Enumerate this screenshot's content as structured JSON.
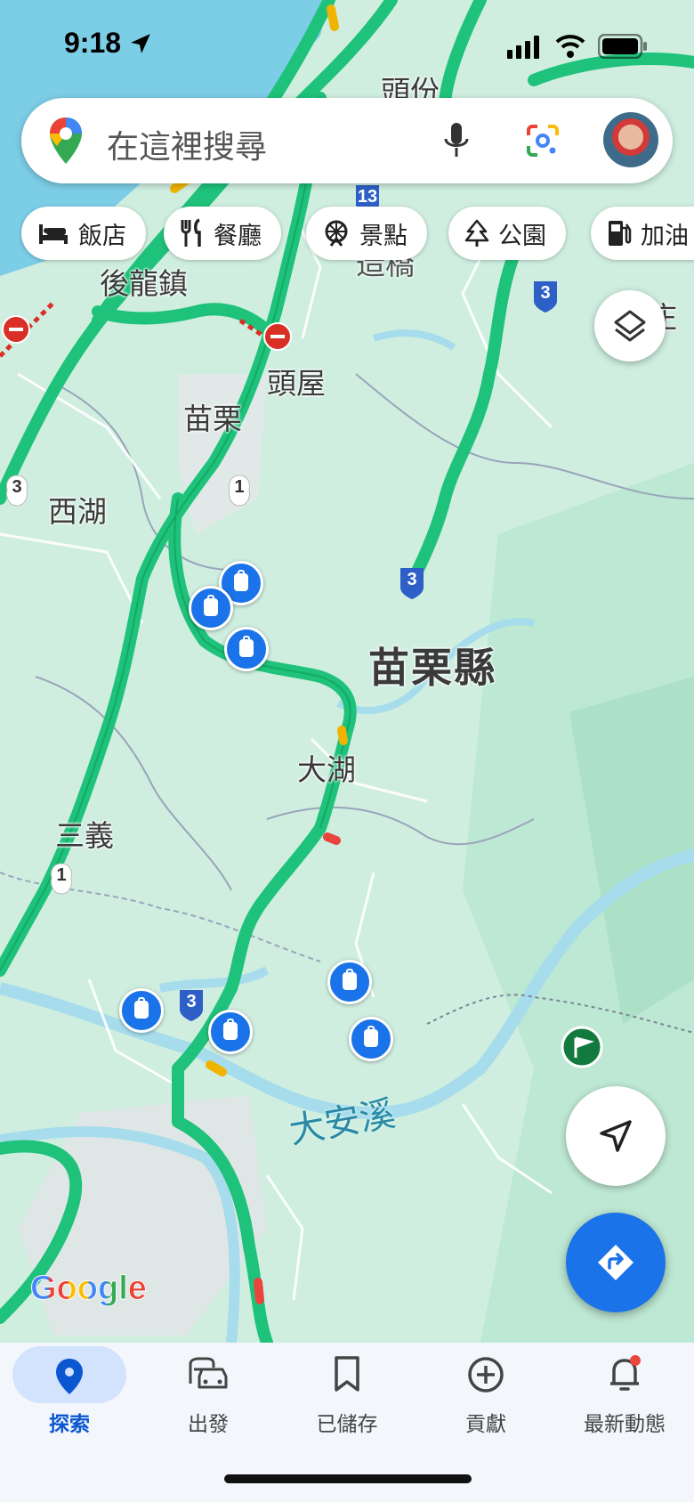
{
  "status_bar": {
    "time": "9:18"
  },
  "search": {
    "placeholder": "在這裡搜尋"
  },
  "chips": [
    {
      "label": "飯店",
      "icon": "bed-icon"
    },
    {
      "label": "餐廳",
      "icon": "restaurant-icon"
    },
    {
      "label": "景點",
      "icon": "attraction-icon"
    },
    {
      "label": "公園",
      "icon": "park-tree-icon"
    },
    {
      "label": "加油",
      "icon": "gas-station-icon"
    }
  ],
  "map": {
    "places": {
      "toufen": "頭份",
      "houlong": "後龍鎮",
      "touwu": "頭屋",
      "miaoli": "苗栗",
      "xihu": "西湖",
      "county": "苗栗縣",
      "dahu": "大湖",
      "sanyi": "三義",
      "partial_top": "造橋",
      "partial_right": "庄"
    },
    "river": "大安溪",
    "route_shields": [
      "13",
      "3",
      "3",
      "1",
      "1",
      "3",
      "3"
    ],
    "attribution": "Google"
  },
  "nav": {
    "items": [
      {
        "label": "探索",
        "icon": "explore-pin-icon",
        "active": true
      },
      {
        "label": "出發",
        "icon": "commute-car-icon"
      },
      {
        "label": "已儲存",
        "icon": "bookmark-icon"
      },
      {
        "label": "貢獻",
        "icon": "add-circle-icon"
      },
      {
        "label": "最新動態",
        "icon": "bell-icon",
        "badge": true
      }
    ]
  },
  "colors": {
    "map_background": "#cfeee0",
    "highway": "#1fc27a",
    "accent_blue": "#1a73e8",
    "river": "#a6dcec"
  }
}
